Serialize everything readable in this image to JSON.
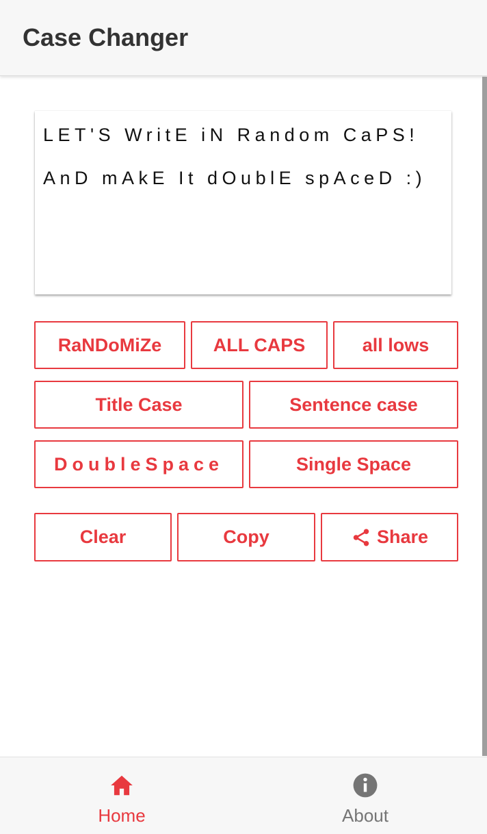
{
  "app": {
    "title": "Case Changer"
  },
  "editor": {
    "text": "LET'S WritE iN Random CaPS!\nAnD mAkE It dOublE spAceD :)"
  },
  "buttons": {
    "randomize": "RaNDoMiZe",
    "all_caps": "ALL CAPS",
    "all_lows": "all lows",
    "title_case": "Title Case",
    "sentence_case": "Sentence case",
    "double_space": "DoubleSpace",
    "single_space": "Single Space",
    "clear": "Clear",
    "copy": "Copy",
    "share": "Share"
  },
  "nav": {
    "home_label": "Home",
    "about_label": "About",
    "home_icon": "home-icon",
    "about_icon": "info-icon",
    "active": "home"
  },
  "colors": {
    "accent": "#e8393f",
    "nav_inactive": "#757575",
    "appbar_bg": "#f7f7f7",
    "title_text": "#333333"
  }
}
